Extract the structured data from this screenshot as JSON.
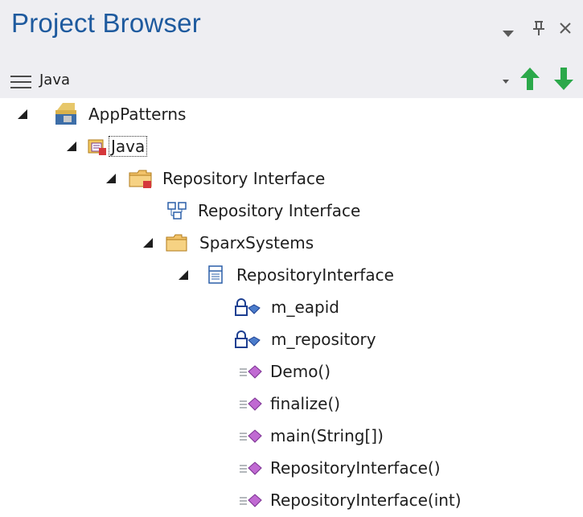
{
  "window": {
    "title": "Project Browser",
    "controls": [
      "dropdown-icon",
      "pin-icon",
      "close-icon"
    ],
    "pin_glyph": "ꟷ",
    "close_glyph": "×"
  },
  "toolbar": {
    "current_package": "Java",
    "move_up_label": "",
    "move_down_label": ""
  },
  "tree": [
    {
      "label": "AppPatterns",
      "icon": "model-root-icon",
      "expanded": true
    },
    {
      "label": "Java",
      "icon": "package-java-icon",
      "expanded": true,
      "selected": true
    },
    {
      "label": "Repository Interface",
      "icon": "package-folder-icon",
      "expanded": true
    },
    {
      "label": "Repository Interface",
      "icon": "class-diagram-icon"
    },
    {
      "label": "SparxSystems",
      "icon": "folder-icon",
      "expanded": true
    },
    {
      "label": "RepositoryInterface",
      "icon": "class-icon",
      "expanded": true
    },
    {
      "label": "m_eapid",
      "icon": "private-attribute-icon"
    },
    {
      "label": "m_repository",
      "icon": "private-attribute-icon"
    },
    {
      "label": "Demo()",
      "icon": "operation-icon"
    },
    {
      "label": "finalize()",
      "icon": "operation-icon"
    },
    {
      "label": "main(String[])",
      "icon": "operation-icon"
    },
    {
      "label": "RepositoryInterface()",
      "icon": "operation-icon"
    },
    {
      "label": "RepositoryInterface(int)",
      "icon": "operation-icon"
    }
  ],
  "colors": {
    "title": "#1e5a9e",
    "panel_bg": "#eeeef2",
    "arrow_up": "#2ba84a",
    "arrow_down": "#2ba84a"
  }
}
